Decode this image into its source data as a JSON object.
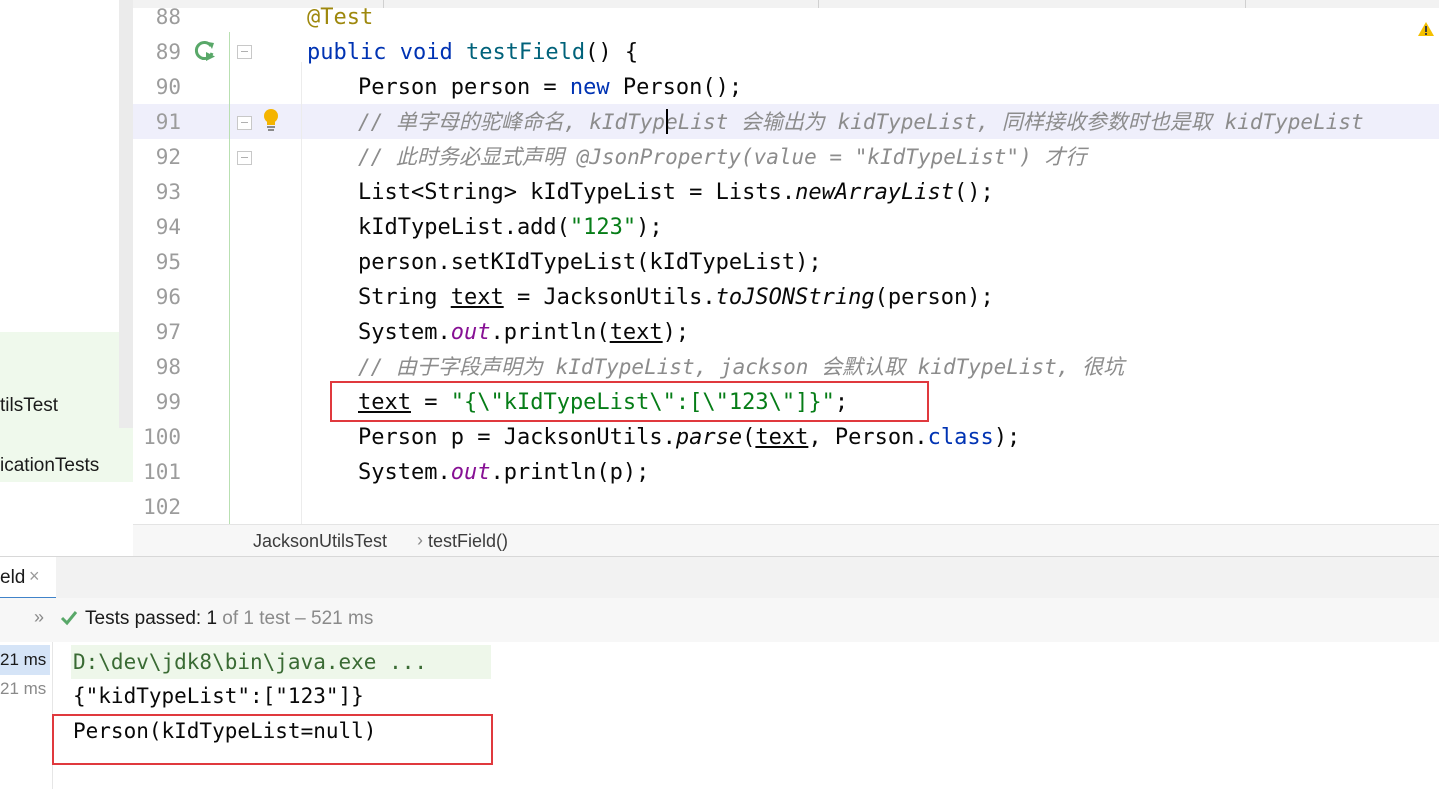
{
  "project_tree": {
    "items": [
      {
        "label": "tilsTest"
      },
      {
        "label": "icationTests"
      }
    ]
  },
  "editor": {
    "lines": [
      {
        "num": "88"
      },
      {
        "num": "89"
      },
      {
        "num": "90"
      },
      {
        "num": "91"
      },
      {
        "num": "92"
      },
      {
        "num": "93"
      },
      {
        "num": "94"
      },
      {
        "num": "95"
      },
      {
        "num": "96"
      },
      {
        "num": "97"
      },
      {
        "num": "98"
      },
      {
        "num": "99"
      },
      {
        "num": "100"
      },
      {
        "num": "101"
      },
      {
        "num": "102"
      }
    ],
    "tokens": {
      "l88_ann": "@Test",
      "l89_public": "public ",
      "l89_void": "void ",
      "l89_name": "testField",
      "l89_rest": "() {",
      "l90_a": "Person person = ",
      "l90_new": "new ",
      "l90_b": "Person();",
      "l91_comment": "// 单字母的驼峰命名, kIdTypeList 会输出为 kidTypeList, 同样接收参数时也是取 kidTypeList",
      "l92_comment": "// 此时务必显式声明 @JsonProperty(value = \"kIdTypeList\") 才行",
      "l93_a": "List<String> kIdTypeList = Lists.",
      "l93_m": "newArrayList",
      "l93_b": "();",
      "l94_a": "kIdTypeList.add(",
      "l94_s": "\"123\"",
      "l94_b": ");",
      "l95": "person.setKIdTypeList(kIdTypeList);",
      "l96_a": "String ",
      "l96_var": "text",
      "l96_b": " = JacksonUtils.",
      "l96_m": "toJSONString",
      "l96_c": "(person);",
      "l97_a": "System.",
      "l97_out": "out",
      "l97_b": ".println(",
      "l97_var": "text",
      "l97_c": ");",
      "l98_comment": "// 由于字段声明为 kIdTypeList, jackson 会默认取 kidTypeList, 很坑",
      "l99_var": "text",
      "l99_eq": " = ",
      "l99_str": "\"{\\\"kIdTypeList\\\":[\\\"123\\\"]}\"",
      "l99_end": ";",
      "l100_a": "Person p = JacksonUtils.",
      "l100_m": "parse",
      "l100_b": "(",
      "l100_var": "text",
      "l100_c": ", Person.",
      "l100_kw": "class",
      "l100_d": ");",
      "l101_a": "System.",
      "l101_out": "out",
      "l101_b": ".println(p);"
    }
  },
  "breadcrumb": {
    "class_name": "JacksonUtilsTest",
    "separator": "›",
    "method_name": "testField()"
  },
  "run_panel": {
    "tab_label": "eld",
    "tab_close": "×",
    "chevron": "»",
    "status_label": "Tests passed: ",
    "status_count": "1",
    "status_rest": " of 1 test – 521 ms",
    "durations": [
      "21 ms",
      "21 ms"
    ],
    "console": [
      "D:\\dev\\jdk8\\bin\\java.exe ...",
      "{\"kidTypeList\":[\"123\"]}",
      "Person(kIdTypeList=null)"
    ]
  },
  "colors": {
    "keyword": "#0033b3",
    "string": "#067d17",
    "comment": "#8c8c8c",
    "annotation": "#9e880d",
    "static_field": "#871094",
    "highlight_box": "#e0393e"
  }
}
